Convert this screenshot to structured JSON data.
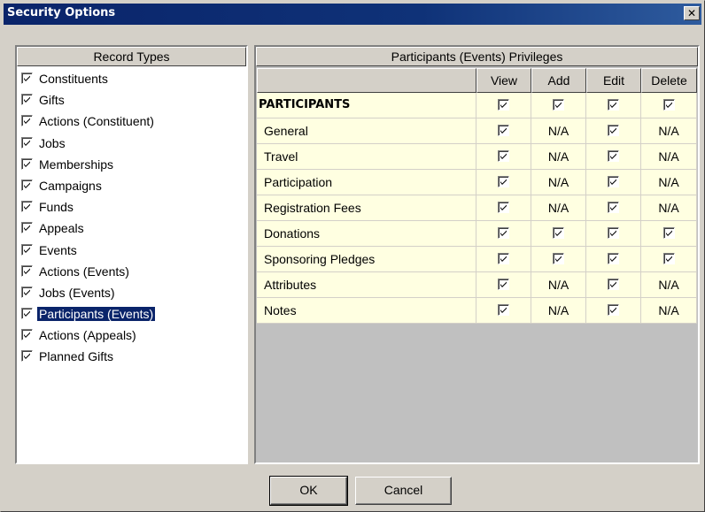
{
  "window": {
    "title": "Security Options",
    "close_glyph": "✕"
  },
  "record_types": {
    "header": "Record Types",
    "items": [
      {
        "label": "Constituents",
        "checked": true
      },
      {
        "label": "Gifts",
        "checked": true
      },
      {
        "label": "Actions (Constituent)",
        "checked": true
      },
      {
        "label": "Jobs",
        "checked": true
      },
      {
        "label": "Memberships",
        "checked": true
      },
      {
        "label": "Campaigns",
        "checked": true
      },
      {
        "label": "Funds",
        "checked": true
      },
      {
        "label": "Appeals",
        "checked": true
      },
      {
        "label": "Events",
        "checked": true
      },
      {
        "label": "Actions (Events)",
        "checked": true
      },
      {
        "label": "Jobs (Events)",
        "checked": true
      },
      {
        "label": "Participants (Events)",
        "checked": true,
        "selected": true
      },
      {
        "label": "Actions (Appeals)",
        "checked": true
      },
      {
        "label": "Planned Gifts",
        "checked": true
      }
    ]
  },
  "privileges": {
    "header": "Participants (Events) Privileges",
    "columns": [
      "View",
      "Add",
      "Edit",
      "Delete"
    ],
    "rows": [
      {
        "name": "PARTICIPANTS",
        "bold": true,
        "cells": [
          "check",
          "check",
          "check",
          "check"
        ]
      },
      {
        "name": "General",
        "cells": [
          "check",
          "N/A",
          "check",
          "N/A"
        ]
      },
      {
        "name": "Travel",
        "cells": [
          "check",
          "N/A",
          "check",
          "N/A"
        ]
      },
      {
        "name": "Participation",
        "cells": [
          "check",
          "N/A",
          "check",
          "N/A"
        ]
      },
      {
        "name": "Registration Fees",
        "cells": [
          "check",
          "N/A",
          "check",
          "N/A"
        ]
      },
      {
        "name": "Donations",
        "cells": [
          "check",
          "check",
          "check",
          "check"
        ]
      },
      {
        "name": "Sponsoring Pledges",
        "cells": [
          "check",
          "check",
          "check",
          "check"
        ]
      },
      {
        "name": "Attributes",
        "cells": [
          "check",
          "N/A",
          "check",
          "N/A"
        ]
      },
      {
        "name": "Notes",
        "cells": [
          "check",
          "N/A",
          "check",
          "N/A"
        ]
      }
    ]
  },
  "buttons": {
    "ok": "OK",
    "cancel": "Cancel"
  },
  "colors": {
    "titlebar": "#0a246a",
    "dialog_face": "#d4d0c8",
    "grid_row_bg": "#ffffe1",
    "grid_empty_bg": "#c0c0c0",
    "selection": "#0a246a"
  }
}
